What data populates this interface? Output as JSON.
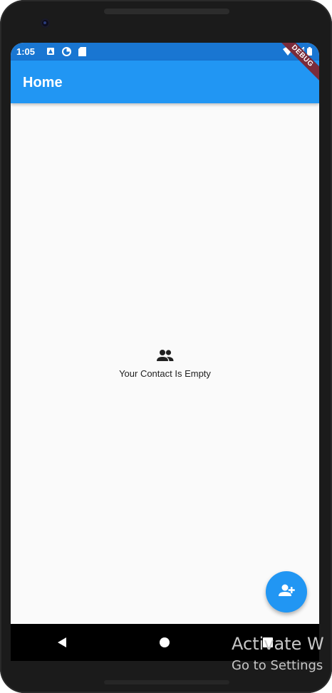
{
  "status_bar": {
    "time": "1:05",
    "icons_left": [
      "notification-a-icon",
      "data-saver-icon",
      "sd-card-icon"
    ],
    "icons_right": [
      "wifi-icon",
      "signal-icon",
      "battery-icon"
    ],
    "color": "#1976d2"
  },
  "debug_banner": {
    "label": "DEBUG"
  },
  "app_bar": {
    "title": "Home",
    "color": "#2196f3"
  },
  "empty_state": {
    "icon": "people-icon",
    "message": "Your Contact Is Empty"
  },
  "fab": {
    "icon": "person-add-icon",
    "color": "#2196f3"
  },
  "nav_bar": {
    "buttons": [
      "back-icon",
      "home-icon",
      "recents-icon"
    ]
  },
  "watermark": {
    "title": "Activate W",
    "subtitle": "Go to Settings"
  }
}
